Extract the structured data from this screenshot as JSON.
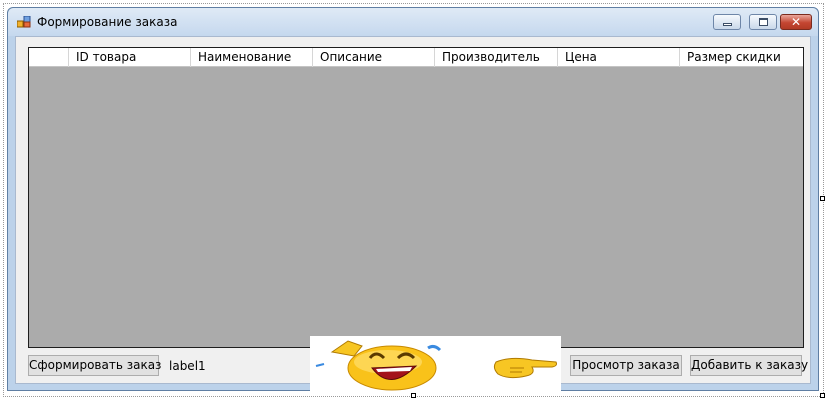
{
  "window": {
    "title": "Формирование заказа",
    "colors": {
      "titlebar": "#c5d8ee",
      "client": "#f0f0f0",
      "close_button": "#c44632"
    }
  },
  "grid": {
    "columns": [
      "",
      "ID товара",
      "Наименование",
      "Описание",
      "Производитель",
      "Цена",
      "Размер скидки"
    ],
    "rows": [],
    "background": "#ababab"
  },
  "controls": {
    "form_order_button": "Сформировать заказ",
    "label1": "label1",
    "view_order_button": "Просмотр заказа",
    "add_to_order_button": "Добавить к заказу"
  },
  "picture": {
    "icon": "laughing-emoji-icon"
  }
}
